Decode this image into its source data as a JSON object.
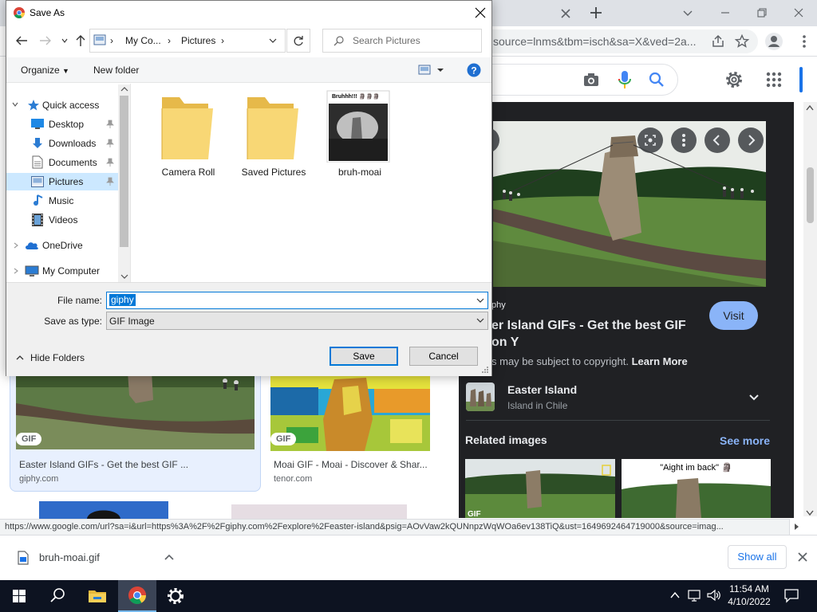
{
  "browser": {
    "url_fragment": "source=lnms&tbm=isch&sa=X&ved=2a...",
    "status_url": "https://www.google.com/url?sa=i&url=https%3A%2F%2Fgiphy.com%2Fexplore%2Feaster-island&psig=AOvVaw2kQUNnpzWqWOa6ev138TiQ&ust=1649692464719000&source=imag..."
  },
  "preview": {
    "source": "phy",
    "title": "er Island GIFs - Get the best GIF on Y",
    "visit_label": "Visit",
    "copyright": "s may be subject to copyright.",
    "learn_more": "Learn More",
    "entity": {
      "title": "Easter Island",
      "subtitle": "Island in Chile"
    },
    "related_title": "Related images",
    "see_more": "See more",
    "related_caption": "\"Aight im back\" 🗿"
  },
  "results": [
    {
      "badge": "GIF",
      "title": "Easter Island GIFs - Get the best GIF ...",
      "source": "giphy.com"
    },
    {
      "badge": "GIF",
      "title": "Moai GIF - Moai - Discover & Shar...",
      "source": "tenor.com"
    }
  ],
  "related_badge": "GIF",
  "download": {
    "filename": "bruh-moai.gif",
    "show_all": "Show all"
  },
  "taskbar": {
    "time": "11:54 AM",
    "date": "4/10/2022"
  },
  "dialog": {
    "title": "Save As",
    "breadcrumb": [
      "My Co...",
      "Pictures"
    ],
    "search_placeholder": "Search Pictures",
    "organize": "Organize",
    "new_folder": "New folder",
    "nav": [
      {
        "label": "Quick access"
      },
      {
        "label": "Desktop"
      },
      {
        "label": "Downloads"
      },
      {
        "label": "Documents"
      },
      {
        "label": "Pictures"
      },
      {
        "label": "Music"
      },
      {
        "label": "Videos"
      },
      {
        "label": "OneDrive"
      },
      {
        "label": "My Computer"
      }
    ],
    "files": [
      {
        "name": "Camera Roll",
        "type": "folder"
      },
      {
        "name": "Saved Pictures",
        "type": "folder"
      },
      {
        "name": "bruh-moai",
        "type": "image",
        "caption": "Bruhhh!!! 🗿🗿🗿"
      }
    ],
    "file_name_label": "File name:",
    "file_name_value": "giphy",
    "save_type_label": "Save as type:",
    "save_type_value": "GIF Image",
    "hide_folders": "Hide Folders",
    "save": "Save",
    "cancel": "Cancel"
  }
}
